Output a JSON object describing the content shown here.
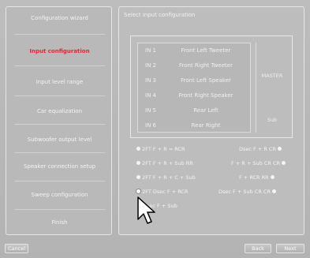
{
  "sidebar": {
    "items": [
      {
        "label": "Configuration wizard",
        "active": false
      },
      {
        "label": "Input configuration",
        "active": true
      },
      {
        "label": "Input level range",
        "active": false
      },
      {
        "label": "Car equalization",
        "active": false
      },
      {
        "label": "Subwoofer output level",
        "active": false
      },
      {
        "label": "Speaker connection setup",
        "active": false
      },
      {
        "label": "Sweep configuration",
        "active": false
      },
      {
        "label": "Finish",
        "active": false
      }
    ]
  },
  "main": {
    "title": "Select input configuration",
    "inputs": [
      {
        "num": "IN 1",
        "label": "Front Left Tweeter"
      },
      {
        "num": "IN 2",
        "label": "Front Right Tweeter"
      },
      {
        "num": "IN 3",
        "label": "Front Left Speaker"
      },
      {
        "num": "IN 4",
        "label": "Front Right Speaker"
      },
      {
        "num": "IN 5",
        "label": "Rear Left"
      },
      {
        "num": "IN 6",
        "label": "Rear Right"
      }
    ],
    "dest_top": "MASTER",
    "dest_bottom": "Sub",
    "options_left": [
      {
        "label": "2FT F + R = RCR",
        "checked": false
      },
      {
        "label": "2FT F + R + Sub RR",
        "checked": false
      },
      {
        "label": "2FT F + R + C + Sub",
        "checked": false
      },
      {
        "label": "2FT Dsec F + RCR",
        "checked": true
      },
      {
        "label": "Dsec F + Sub",
        "checked": false
      }
    ],
    "options_right": [
      {
        "label": "Dsec F + R CR",
        "checked": false
      },
      {
        "label": "F + R + Sub CR CR",
        "checked": false
      },
      {
        "label": "F + RCR RR",
        "checked": false
      },
      {
        "label": "Dsec F + Sub CR CR",
        "checked": false
      }
    ]
  },
  "footer": {
    "cancel": "Cancel",
    "back": "Back",
    "next": "Next"
  },
  "colors": {
    "active_item": "#e8262f",
    "background": "#bdbdbd"
  }
}
